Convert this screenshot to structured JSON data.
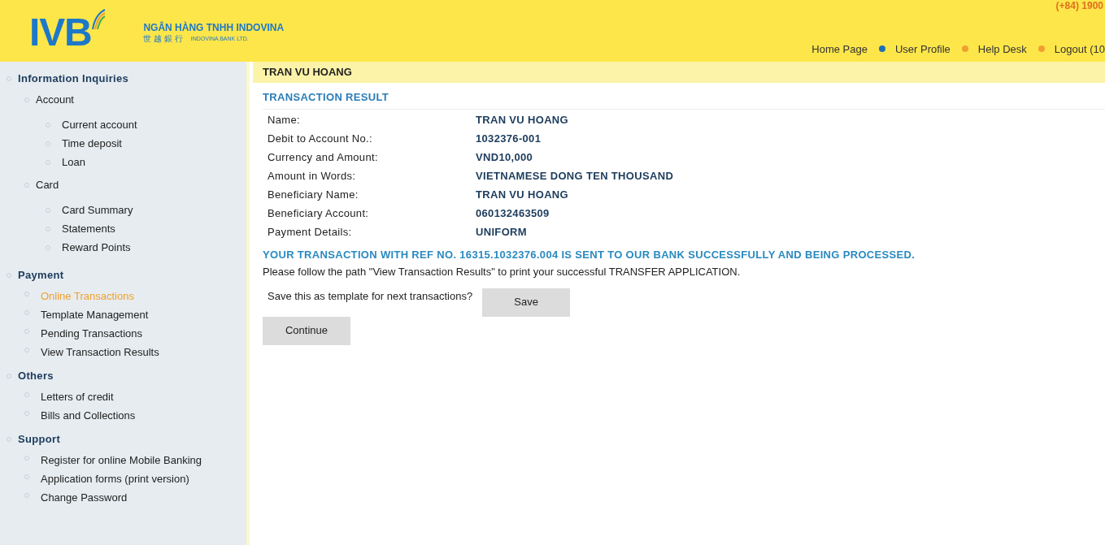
{
  "header": {
    "logo_text": "IVB",
    "bank_name": "NGÂN HÀNG TNHH INDOVINA",
    "bank_name_chinese": "世 越 銀 行",
    "bank_name_english": "INDOVINA BANK LTD.",
    "phone": "(+84) 1900",
    "nav": [
      {
        "label": "Home Page"
      },
      {
        "label": "User Profile",
        "color": "#1f6fb5"
      },
      {
        "label": "Help Desk",
        "color": "#f0a030"
      },
      {
        "label": "Logout (10",
        "color": "#f0a030"
      }
    ]
  },
  "sidebar": {
    "sections": [
      {
        "label": "Information Inquiries",
        "children": [
          {
            "label": "Account",
            "children": [
              {
                "label": "Current account",
                "selected": false
              },
              {
                "label": "Time deposit",
                "selected": false
              },
              {
                "label": "Loan",
                "selected": false
              }
            ]
          },
          {
            "label": "Card",
            "children": [
              {
                "label": "Card Summary",
                "selected": false
              },
              {
                "label": "Statements",
                "selected": false
              },
              {
                "label": "Reward Points",
                "selected": false
              }
            ]
          }
        ]
      },
      {
        "label": "Payment",
        "children": [
          {
            "label": "Online Transactions",
            "selected": true
          },
          {
            "label": "Template Management",
            "selected": false
          },
          {
            "label": "Pending Transactions",
            "selected": false
          },
          {
            "label": "View Transaction Results",
            "selected": false
          }
        ]
      },
      {
        "label": "Others",
        "children": [
          {
            "label": "Letters of credit",
            "selected": false
          },
          {
            "label": "Bills and Collections",
            "selected": false
          }
        ]
      },
      {
        "label": "Support",
        "children": [
          {
            "label": "Register for online Mobile Banking",
            "selected": false
          },
          {
            "label": "Application forms (print version)",
            "selected": false
          },
          {
            "label": "Change Password",
            "selected": false
          }
        ]
      }
    ]
  },
  "main": {
    "user_name": "TRAN VU HOANG",
    "section_title": "TRANSACTION RESULT",
    "rows": [
      {
        "label": "Name:",
        "value": "TRAN VU HOANG"
      },
      {
        "label": "Debit to Account No.:",
        "value": "1032376-001"
      },
      {
        "label": "Currency and Amount:",
        "value": "VND10,000"
      },
      {
        "label": "Amount in Words:",
        "value": "VIETNAMESE DONG TEN THOUSAND"
      },
      {
        "label": "Beneficiary Name:",
        "value": "TRAN VU HOANG"
      },
      {
        "label": "Beneficiary Account:",
        "value": "060132463509"
      },
      {
        "label": "Payment Details:",
        "value": "UNIFORM"
      }
    ],
    "success_message": "YOUR TRANSACTION WITH REF NO. 16315.1032376.004 IS SENT TO OUR BANK SUCCESSFULLY AND BEING PROCESSED.",
    "instruction": "Please follow the path \"View Transaction Results\" to print your successful TRANSFER APPLICATION.",
    "template_prompt": "Save this as template for next transactions?",
    "save_button": "Save",
    "continue_button": "Continue"
  }
}
